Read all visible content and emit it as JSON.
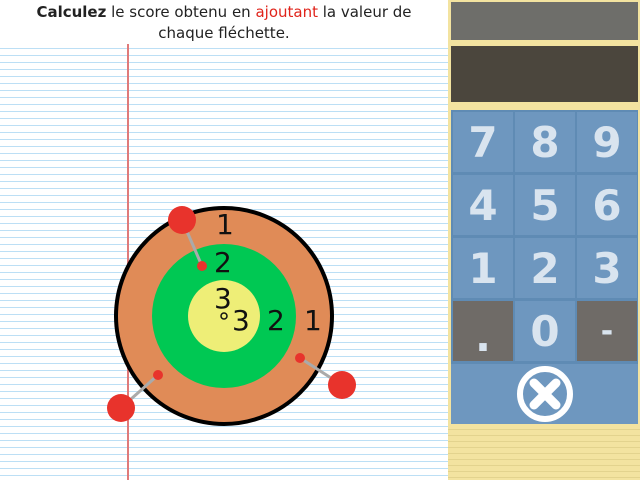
{
  "instruction": {
    "part1": "Calculez",
    "part2": " le score obtenu en ",
    "part3": "ajoutant",
    "part4": " la valeur de chaque fléchette."
  },
  "target": {
    "ring_labels": {
      "outer_top": "1",
      "outer_right": "1",
      "middle_top": "2",
      "middle_right": "2",
      "inner_top": "3",
      "inner_right": "3"
    },
    "colors": {
      "outer": "#e08b57",
      "middle": "#00c853",
      "inner": "#eeee77",
      "dart": "#e8332c"
    }
  },
  "display": {
    "answer": "",
    "work": ""
  },
  "keypad": {
    "keys": [
      "7",
      "8",
      "9",
      "4",
      "5",
      "6",
      "1",
      "2",
      "3",
      ".",
      "0",
      "-"
    ],
    "clear_icon": "close-circle-icon"
  },
  "colors": {
    "keypad_bg": "#5f8bb4",
    "key": "#6e97bf",
    "key_dark": "#6f6b67",
    "panel": "#f3e3a0"
  }
}
